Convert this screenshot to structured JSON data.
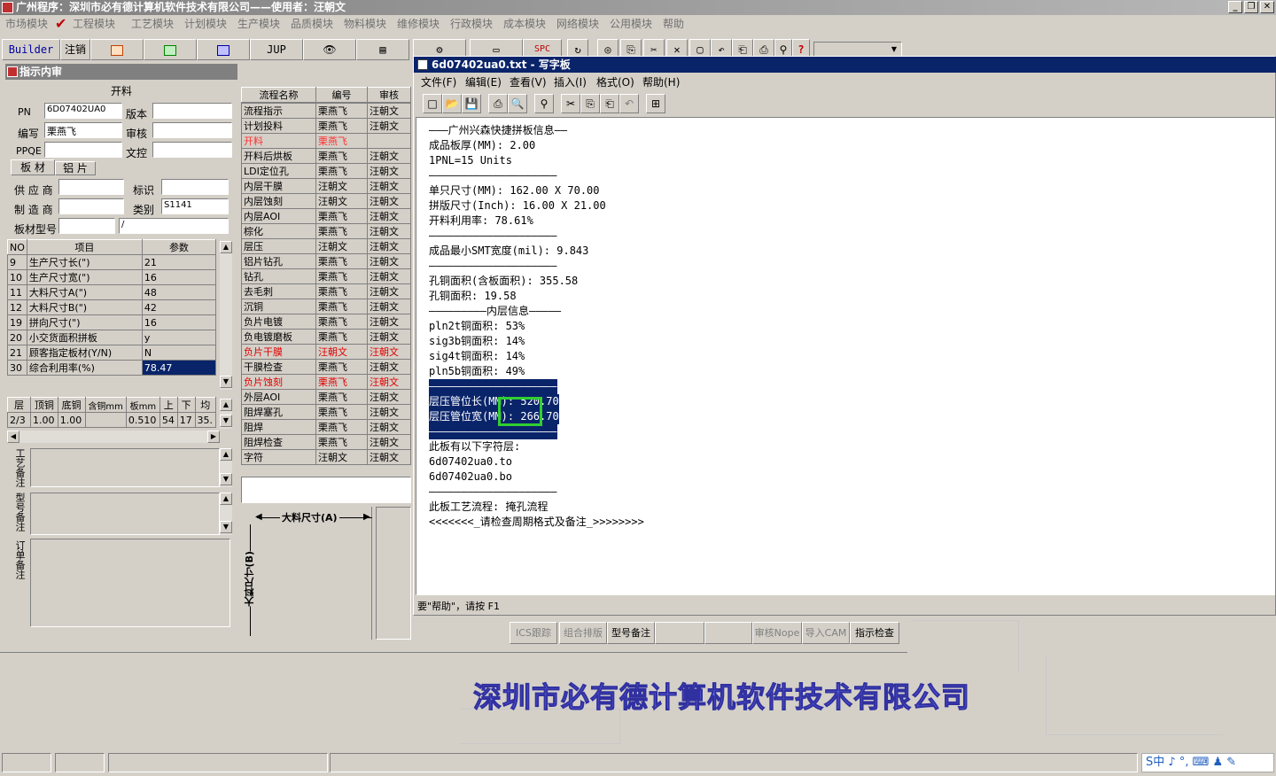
{
  "app": {
    "title": "广州程序：深圳市必有德计算机软件技术有限公司——使用者：汪朝文"
  },
  "menu": [
    "市场模块",
    "✔",
    "工程模块",
    "工艺模块",
    "计划模块",
    "生产模块",
    "品质模块",
    "物料模块",
    "维修模块",
    "行政模块",
    "成本模块",
    "网络模块",
    "公用模块",
    "帮助"
  ],
  "toolbar": {
    "builder": "Builder",
    "logout": "注销",
    "jup": "JUP",
    "spc": "SPC"
  },
  "left": {
    "title": "指示内审",
    "section": "开料",
    "pn_label": "PN",
    "pn_value": "6D07402UA0",
    "version_label": "版本",
    "version_value": "",
    "author_label": "编写",
    "author_value": "栗燕飞",
    "review_label": "审核",
    "review_value": "",
    "ppqe_label": "PPQE",
    "ppqe_value": "",
    "doc_label": "文控",
    "doc_value": "",
    "tabs": [
      "板 材",
      "铝 片"
    ],
    "supplier_label": "供 应 商",
    "supplier_value": "",
    "mark_label": "标识",
    "mark_value": "",
    "maker_label": "制 造 商",
    "maker_value": "",
    "type_label": "类别",
    "type_value": "S1141",
    "board_model_label": "板材型号",
    "board_model_value": "",
    "board_model_value2": "/",
    "param_headers": [
      "NO",
      "项目",
      "参数"
    ],
    "params": [
      {
        "no": "9",
        "item": "生产尺寸长(\")",
        "val": "21"
      },
      {
        "no": "10",
        "item": "生产尺寸宽(\")",
        "val": "16"
      },
      {
        "no": "11",
        "item": "大料尺寸A(\")",
        "val": "48"
      },
      {
        "no": "12",
        "item": "大料尺寸B(\")",
        "val": "42"
      },
      {
        "no": "19",
        "item": "拼向尺寸(\")",
        "val": "16"
      },
      {
        "no": "20",
        "item": "小交货面积拼板",
        "val": "y"
      },
      {
        "no": "21",
        "item": "顾客指定板材(Y/N)",
        "val": "N"
      },
      {
        "no": "30",
        "item": "综合利用率(%)",
        "val": "78.47"
      }
    ],
    "layer_headers": [
      "层",
      "顶铜",
      "底铜",
      "含铜mm",
      "板mm",
      "上",
      "下",
      "均"
    ],
    "layer_row": [
      "2/3",
      "1.00",
      "1.00",
      "",
      "0.510",
      "54",
      "17",
      "35."
    ],
    "remarks": [
      "工艺备注",
      "型号备注",
      "订单备注"
    ]
  },
  "flow": {
    "headers": [
      "流程名称",
      "编号",
      "审核"
    ],
    "rows": [
      {
        "name": "流程指示",
        "num": "栗燕飞",
        "rev": "汪朝文"
      },
      {
        "name": "计划投料",
        "num": "栗燕飞",
        "rev": "汪朝文"
      },
      {
        "name": "开料",
        "num": "栗燕飞",
        "rev": ""
      },
      {
        "name": "开料后烘板",
        "num": "栗燕飞",
        "rev": "汪朝文"
      },
      {
        "name": "LDI定位孔",
        "num": "栗燕飞",
        "rev": "汪朝文"
      },
      {
        "name": "内层干膜",
        "num": "汪朝文",
        "rev": "汪朝文"
      },
      {
        "name": "内层蚀刻",
        "num": "汪朝文",
        "rev": "汪朝文"
      },
      {
        "name": "内层AOI",
        "num": "栗燕飞",
        "rev": "汪朝文"
      },
      {
        "name": "棕化",
        "num": "栗燕飞",
        "rev": "汪朝文"
      },
      {
        "name": "层压",
        "num": "汪朝文",
        "rev": "汪朝文"
      },
      {
        "name": "铝片钻孔",
        "num": "栗燕飞",
        "rev": "汪朝文"
      },
      {
        "name": "钻孔",
        "num": "栗燕飞",
        "rev": "汪朝文"
      },
      {
        "name": "去毛刺",
        "num": "栗燕飞",
        "rev": "汪朝文"
      },
      {
        "name": "沉铜",
        "num": "栗燕飞",
        "rev": "汪朝文"
      },
      {
        "name": "负片电镀",
        "num": "栗燕飞",
        "rev": "汪朝文"
      },
      {
        "name": "负电镀磨板",
        "num": "栗燕飞",
        "rev": "汪朝文"
      },
      {
        "name": "负片干膜",
        "num": "汪朝文",
        "rev": "汪朝文"
      },
      {
        "name": "干膜检查",
        "num": "栗燕飞",
        "rev": "汪朝文"
      },
      {
        "name": "负片蚀刻",
        "num": "栗燕飞",
        "rev": "汪朝文"
      },
      {
        "name": "外层AOI",
        "num": "栗燕飞",
        "rev": "汪朝文"
      },
      {
        "name": "阻焊塞孔",
        "num": "栗燕飞",
        "rev": "汪朝文"
      },
      {
        "name": "阻焊",
        "num": "栗燕飞",
        "rev": "汪朝文"
      },
      {
        "name": "阻焊检查",
        "num": "栗燕飞",
        "rev": "汪朝文"
      },
      {
        "name": "字符",
        "num": "汪朝文",
        "rev": "汪朝文"
      }
    ],
    "dim_a": "大料尺寸(A)",
    "dim_b": "大料尺寸(B)"
  },
  "wordpad": {
    "title": "6d07402ua0.txt - 写字板",
    "menu": [
      "文件(F)",
      "编辑(E)",
      "查看(V)",
      "插入(I)",
      "格式(O)",
      "帮助(H)"
    ],
    "lines": [
      "———广州兴森快捷拼板信息——",
      "成品板厚(MM): 2.00",
      "1PNL=15 Units",
      "————————————————————",
      "单只尺寸(MM): 162.00 X 70.00",
      "拼版尺寸(Inch): 16.00 X 21.00",
      "开料利用率: 78.61%",
      "————————————————————",
      "成品最小SMT宽度(mil): 9.843",
      "————————————————————",
      "孔铜面积(含板面积): 355.58",
      "孔铜面积: 19.58",
      "—————————内层信息—————",
      "pln2t铜面积: 53%",
      "sig3b铜面积: 14%",
      "sig4t铜面积: 14%",
      "pln5b铜面积: 49%",
      "————————————————————",
      "层压管位长(MM): 520.70",
      "层压管位宽(MM): 266.70",
      "————————————————————",
      "此板有以下字符层:",
      "6d07402ua0.to",
      "6d07402ua0.bo",
      "————————————————————",
      "此板工艺流程: 掩孔流程",
      "<<<<<<<_请检查周期格式及备注_>>>>>>>>"
    ],
    "status": "要\"帮助\"，请按 F1"
  },
  "bottom_buttons": [
    "ICS跟踪",
    "组合排版",
    "型号备注",
    "",
    "",
    "审核Nope",
    "导入CAM",
    "指示检查"
  ],
  "banner": "深圳市必有德计算机软件技术有限公司",
  "tray": "S中 ♪ °, ⌨ ♟ ✎"
}
